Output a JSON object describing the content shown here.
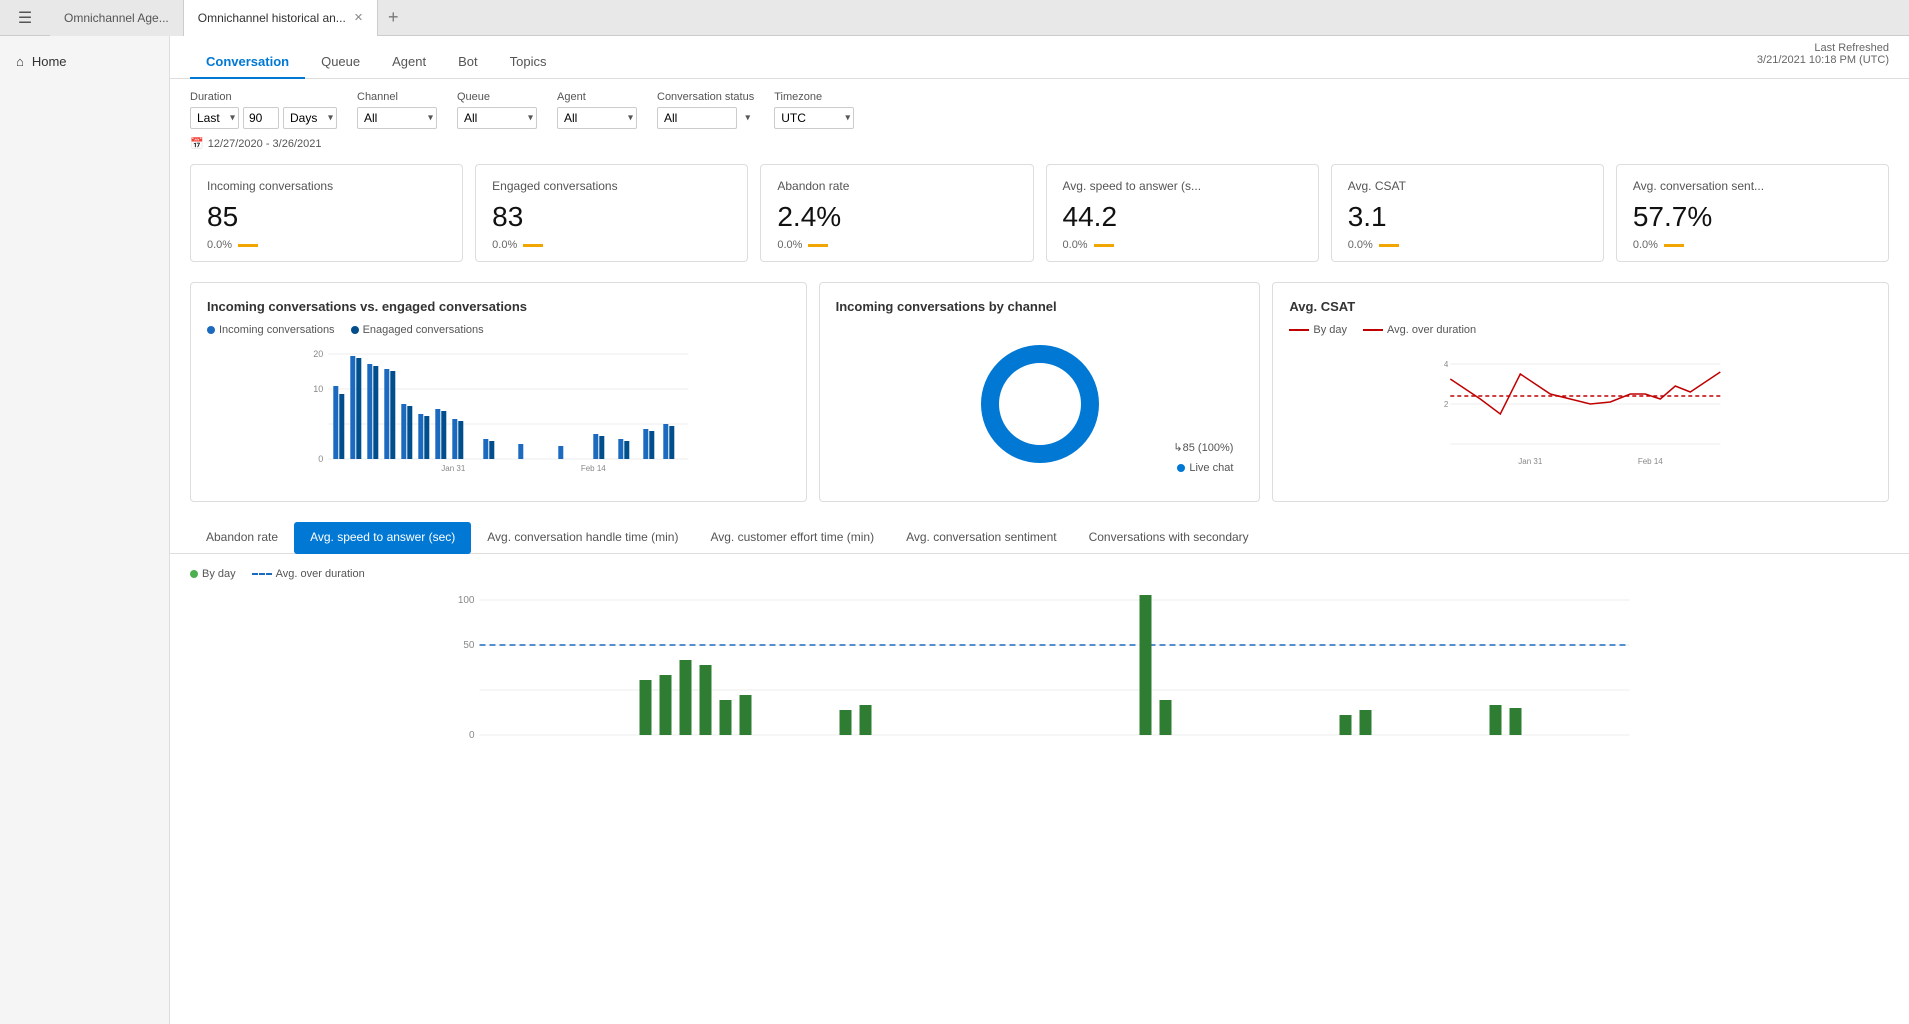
{
  "tabs": [
    {
      "label": "Omnichannel Age...",
      "active": false
    },
    {
      "label": "Omnichannel historical an...",
      "active": true
    }
  ],
  "sidebar": {
    "home_label": "Home"
  },
  "header": {
    "last_refreshed_label": "Last Refreshed",
    "last_refreshed_value": "3/21/2021 10:18 PM (UTC)"
  },
  "nav_tabs": [
    {
      "label": "Conversation",
      "active": true
    },
    {
      "label": "Queue",
      "active": false
    },
    {
      "label": "Agent",
      "active": false
    },
    {
      "label": "Bot",
      "active": false
    },
    {
      "label": "Topics",
      "active": false
    }
  ],
  "filters": {
    "duration_label": "Duration",
    "duration_option": "Last",
    "duration_days": "90",
    "duration_unit": "Days",
    "channel_label": "Channel",
    "channel_value": "All",
    "queue_label": "Queue",
    "queue_value": "All",
    "agent_label": "Agent",
    "agent_value": "All",
    "conv_status_label": "Conversation status",
    "conv_status_value": "All",
    "timezone_label": "Timezone",
    "timezone_value": "UTC",
    "date_range": "12/27/2020 - 3/26/2021"
  },
  "kpi_cards": [
    {
      "title": "Incoming conversations",
      "value": "85",
      "change": "0.0%",
      "id": "incoming"
    },
    {
      "title": "Engaged conversations",
      "value": "83",
      "change": "0.0%",
      "id": "engaged"
    },
    {
      "title": "Abandon rate",
      "value": "2.4%",
      "change": "0.0%",
      "id": "abandon"
    },
    {
      "title": "Avg. speed to answer (s...",
      "value": "44.2",
      "change": "0.0%",
      "id": "speed"
    },
    {
      "title": "Avg. CSAT",
      "value": "3.1",
      "change": "0.0%",
      "id": "csat"
    },
    {
      "title": "Avg. conversation sent...",
      "value": "57.7%",
      "change": "0.0%",
      "id": "sentiment"
    }
  ],
  "charts": {
    "bar_title": "Incoming conversations vs. engaged conversations",
    "bar_legend": [
      {
        "label": "Incoming conversations",
        "color": "#1c6abf"
      },
      {
        "label": "Enagaged conversations",
        "color": "#004e8c"
      }
    ],
    "bar_x_labels": [
      "Jan 31",
      "Feb 14"
    ],
    "donut_title": "Incoming conversations by channel",
    "donut_legend": [
      {
        "label": "Live chat",
        "color": "#0078d4"
      }
    ],
    "donut_value": "85 (100%)",
    "line_title": "Avg. CSAT",
    "line_legend": [
      {
        "label": "By day",
        "color": "#c00000",
        "style": "solid"
      },
      {
        "label": "Avg. over duration",
        "color": "#c00000",
        "style": "dashed"
      }
    ],
    "line_x_labels": [
      "Jan 31",
      "Feb 14"
    ],
    "line_y_labels": [
      "4",
      "2"
    ]
  },
  "bottom_tabs": [
    {
      "label": "Abandon rate"
    },
    {
      "label": "Avg. speed to answer (sec)",
      "active": true
    },
    {
      "label": "Avg. conversation handle time (min)"
    },
    {
      "label": "Avg. customer effort time (min)"
    },
    {
      "label": "Avg. conversation sentiment"
    },
    {
      "label": "Conversations with secondary"
    }
  ],
  "bottom_chart": {
    "legend": [
      {
        "label": "By day",
        "color": "#4caf50",
        "style": "circle"
      },
      {
        "label": "Avg. over duration",
        "color": "#1c6abf",
        "style": "dashed"
      }
    ],
    "y_labels": [
      "100",
      "50",
      "0"
    ]
  }
}
